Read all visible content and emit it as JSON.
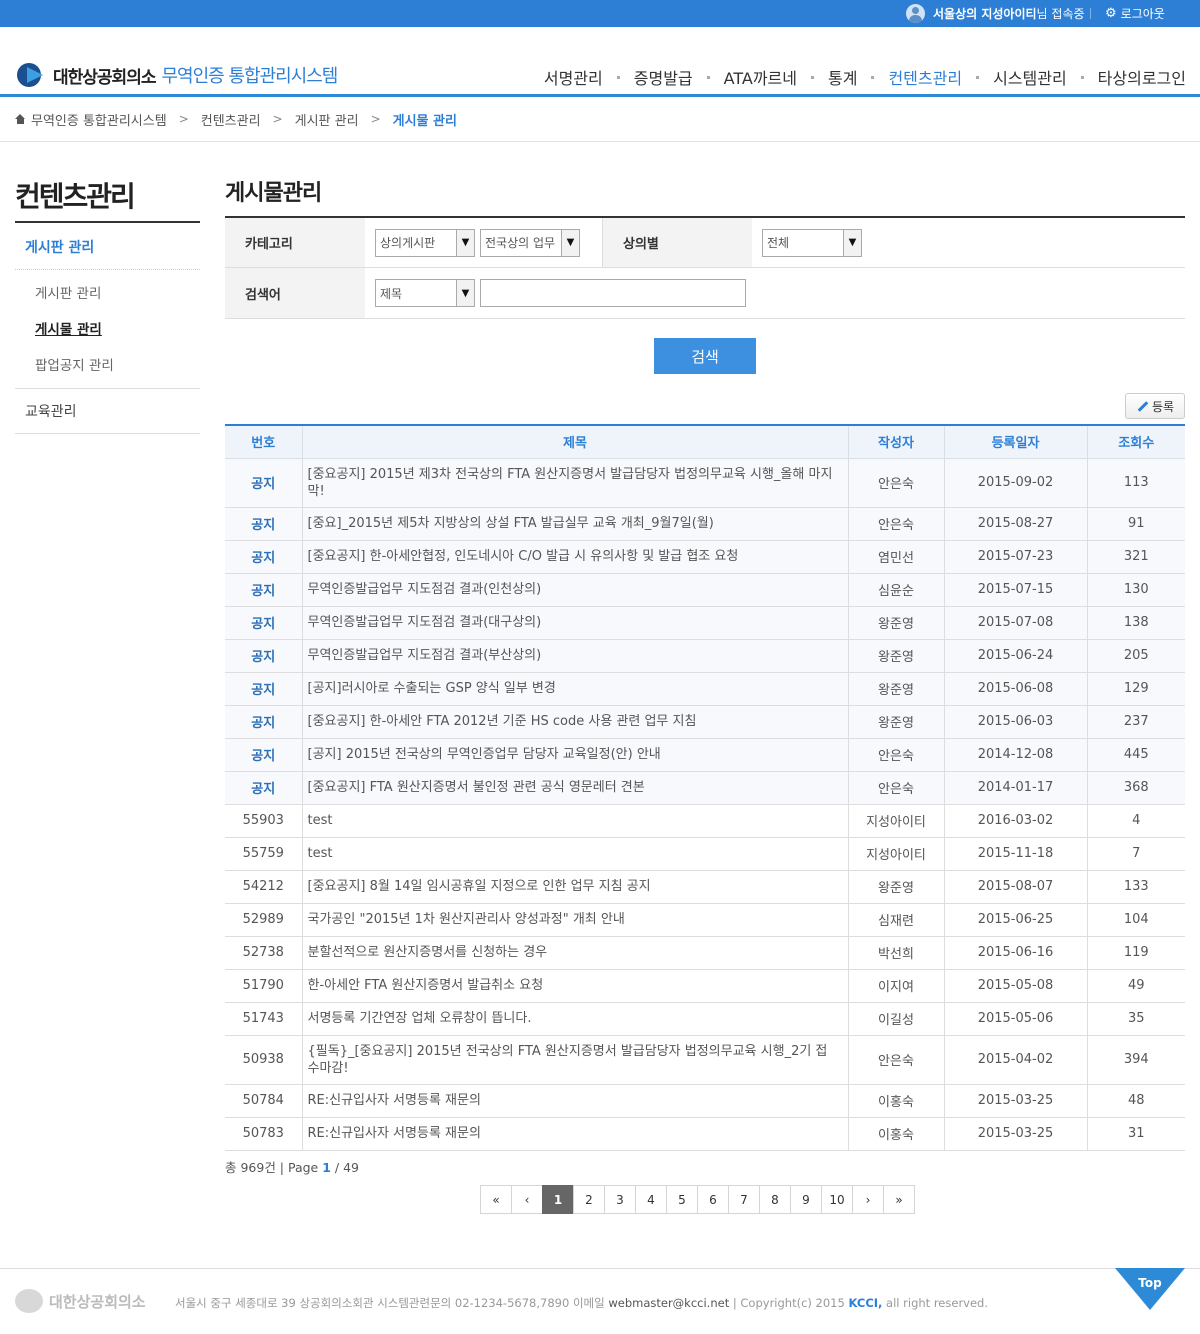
{
  "topbar": {
    "user_name": "서울상의 지성아이티",
    "user_suffix": "님 접속중",
    "logout": "로그아웃"
  },
  "header": {
    "org_name": "대한상공회의소",
    "system_name": "무역인증 통합관리시스템",
    "nav": [
      "서명관리",
      "증명발급",
      "ATA까르네",
      "통계",
      "컨텐츠관리",
      "시스템관리",
      "타상의로그인"
    ],
    "active_nav": "컨텐츠관리"
  },
  "breadcrumb": [
    "무역인증 통합관리시스템",
    "컨텐츠관리",
    "게시판 관리",
    "게시물 관리"
  ],
  "sidebar": {
    "title": "컨텐츠관리",
    "group1": "게시판 관리",
    "subs": [
      "게시판 관리",
      "게시물 관리",
      "팝업공지 관리"
    ],
    "group2": "교육관리"
  },
  "main": {
    "title": "게시물관리",
    "search": {
      "category_label": "카테고리",
      "category_value1": "상의게시판",
      "category_value2": "전국상의 업무",
      "chamber_label": "상의별",
      "chamber_value": "전체",
      "keyword_label": "검색어",
      "keyword_field": "제목",
      "keyword_value": "",
      "button": "검색"
    },
    "register_button": "등록",
    "columns": [
      "번호",
      "제목",
      "작성자",
      "등록일자",
      "조회수"
    ],
    "rows": [
      {
        "num": "공지",
        "title": "[중요공지] 2015년 제3차 전국상의 FTA 원산지증명서 발급담당자 법정의무교육 시행_올해 마지막!",
        "author": "안은숙",
        "date": "2015-09-02",
        "views": "113",
        "notice": true,
        "tall": true
      },
      {
        "num": "공지",
        "title": "[중요]_2015년 제5차 지방상의 상설 FTA 발급실무 교육 개최_9월7일(월)",
        "author": "안은숙",
        "date": "2015-08-27",
        "views": "91",
        "notice": true
      },
      {
        "num": "공지",
        "title": "[중요공지] 한-아세안협정, 인도네시아 C/O 발급 시 유의사항 및 발급 협조 요청",
        "author": "염민선",
        "date": "2015-07-23",
        "views": "321",
        "notice": true
      },
      {
        "num": "공지",
        "title": "무역인증발급업무 지도점검 결과(인천상의)",
        "author": "심윤순",
        "date": "2015-07-15",
        "views": "130",
        "notice": true
      },
      {
        "num": "공지",
        "title": "무역인증발급업무 지도점검 결과(대구상의)",
        "author": "왕준영",
        "date": "2015-07-08",
        "views": "138",
        "notice": true
      },
      {
        "num": "공지",
        "title": "무역인증발급업무 지도점검 결과(부산상의)",
        "author": "왕준영",
        "date": "2015-06-24",
        "views": "205",
        "notice": true
      },
      {
        "num": "공지",
        "title": "[공지]러시아로 수출되는 GSP 양식 일부 변경",
        "author": "왕준영",
        "date": "2015-06-08",
        "views": "129",
        "notice": true
      },
      {
        "num": "공지",
        "title": "[중요공지] 한-아세안 FTA 2012년 기준 HS code 사용 관련 업무 지침",
        "author": "왕준영",
        "date": "2015-06-03",
        "views": "237",
        "notice": true
      },
      {
        "num": "공지",
        "title": "[공지] 2015년 전국상의 무역인증업무 담당자 교육일정(안) 안내",
        "author": "안은숙",
        "date": "2014-12-08",
        "views": "445",
        "notice": true
      },
      {
        "num": "공지",
        "title": "[중요공지] FTA 원산지증명서 불인정 관련 공식 영문레터 견본",
        "author": "안은숙",
        "date": "2014-01-17",
        "views": "368",
        "notice": true
      },
      {
        "num": "55903",
        "title": "test",
        "author": "지성아이티",
        "date": "2016-03-02",
        "views": "4"
      },
      {
        "num": "55759",
        "title": "test",
        "author": "지성아이티",
        "date": "2015-11-18",
        "views": "7"
      },
      {
        "num": "54212",
        "title": "[중요공지] 8월 14일 임시공휴일 지정으로 인한 업무 지침 공지",
        "author": "왕준영",
        "date": "2015-08-07",
        "views": "133"
      },
      {
        "num": "52989",
        "title": "국가공인 \"2015년 1차 원산지관리사 양성과정\" 개최 안내",
        "author": "심재련",
        "date": "2015-06-25",
        "views": "104"
      },
      {
        "num": "52738",
        "title": "분할선적으로 원산지증명서를 신청하는 경우",
        "author": "박선희",
        "date": "2015-06-16",
        "views": "119"
      },
      {
        "num": "51790",
        "title": "한-아세안 FTA 원산지증명서 발급취소 요청",
        "author": "이지여",
        "date": "2015-05-08",
        "views": "49"
      },
      {
        "num": "51743",
        "title": "서명등록 기간연장 업체 오류창이 뜹니다.",
        "author": "이길성",
        "date": "2015-05-06",
        "views": "35"
      },
      {
        "num": "50938",
        "title": "{필독}_[중요공지] 2015년 전국상의 FTA 원산지증명서 발급담당자 법정의무교육 시행_2기 접수마감!",
        "author": "안은숙",
        "date": "2015-04-02",
        "views": "394",
        "tall": true
      },
      {
        "num": "50784",
        "title": "RE:신규입사자 서명등록 재문의",
        "author": "이홍숙",
        "date": "2015-03-25",
        "views": "48"
      },
      {
        "num": "50783",
        "title": "RE:신규입사자 서명등록 재문의",
        "author": "이홍숙",
        "date": "2015-03-25",
        "views": "31"
      }
    ],
    "total_prefix": "총 969건 | Page ",
    "page_current": "1",
    "page_total_suffix": " / 49"
  },
  "pagination": {
    "first": "«",
    "prev": "‹",
    "pages": [
      "1",
      "2",
      "3",
      "4",
      "5",
      "6",
      "7",
      "8",
      "9",
      "10"
    ],
    "active": "1",
    "next": "›",
    "last": "»"
  },
  "footer": {
    "org_name": "대한상공회의소",
    "address": "서울시 중구 세종대로 39 상공회의소회관 시스템관련문의 02-1234-5678,7890 이메일 ",
    "email": "webmaster@kcci.net",
    "copyright_prefix": " | Copyright(c) 2015 ",
    "kcci": "KCCI,",
    "copyright_suffix": " all right reserved.",
    "top_button": "Top"
  }
}
